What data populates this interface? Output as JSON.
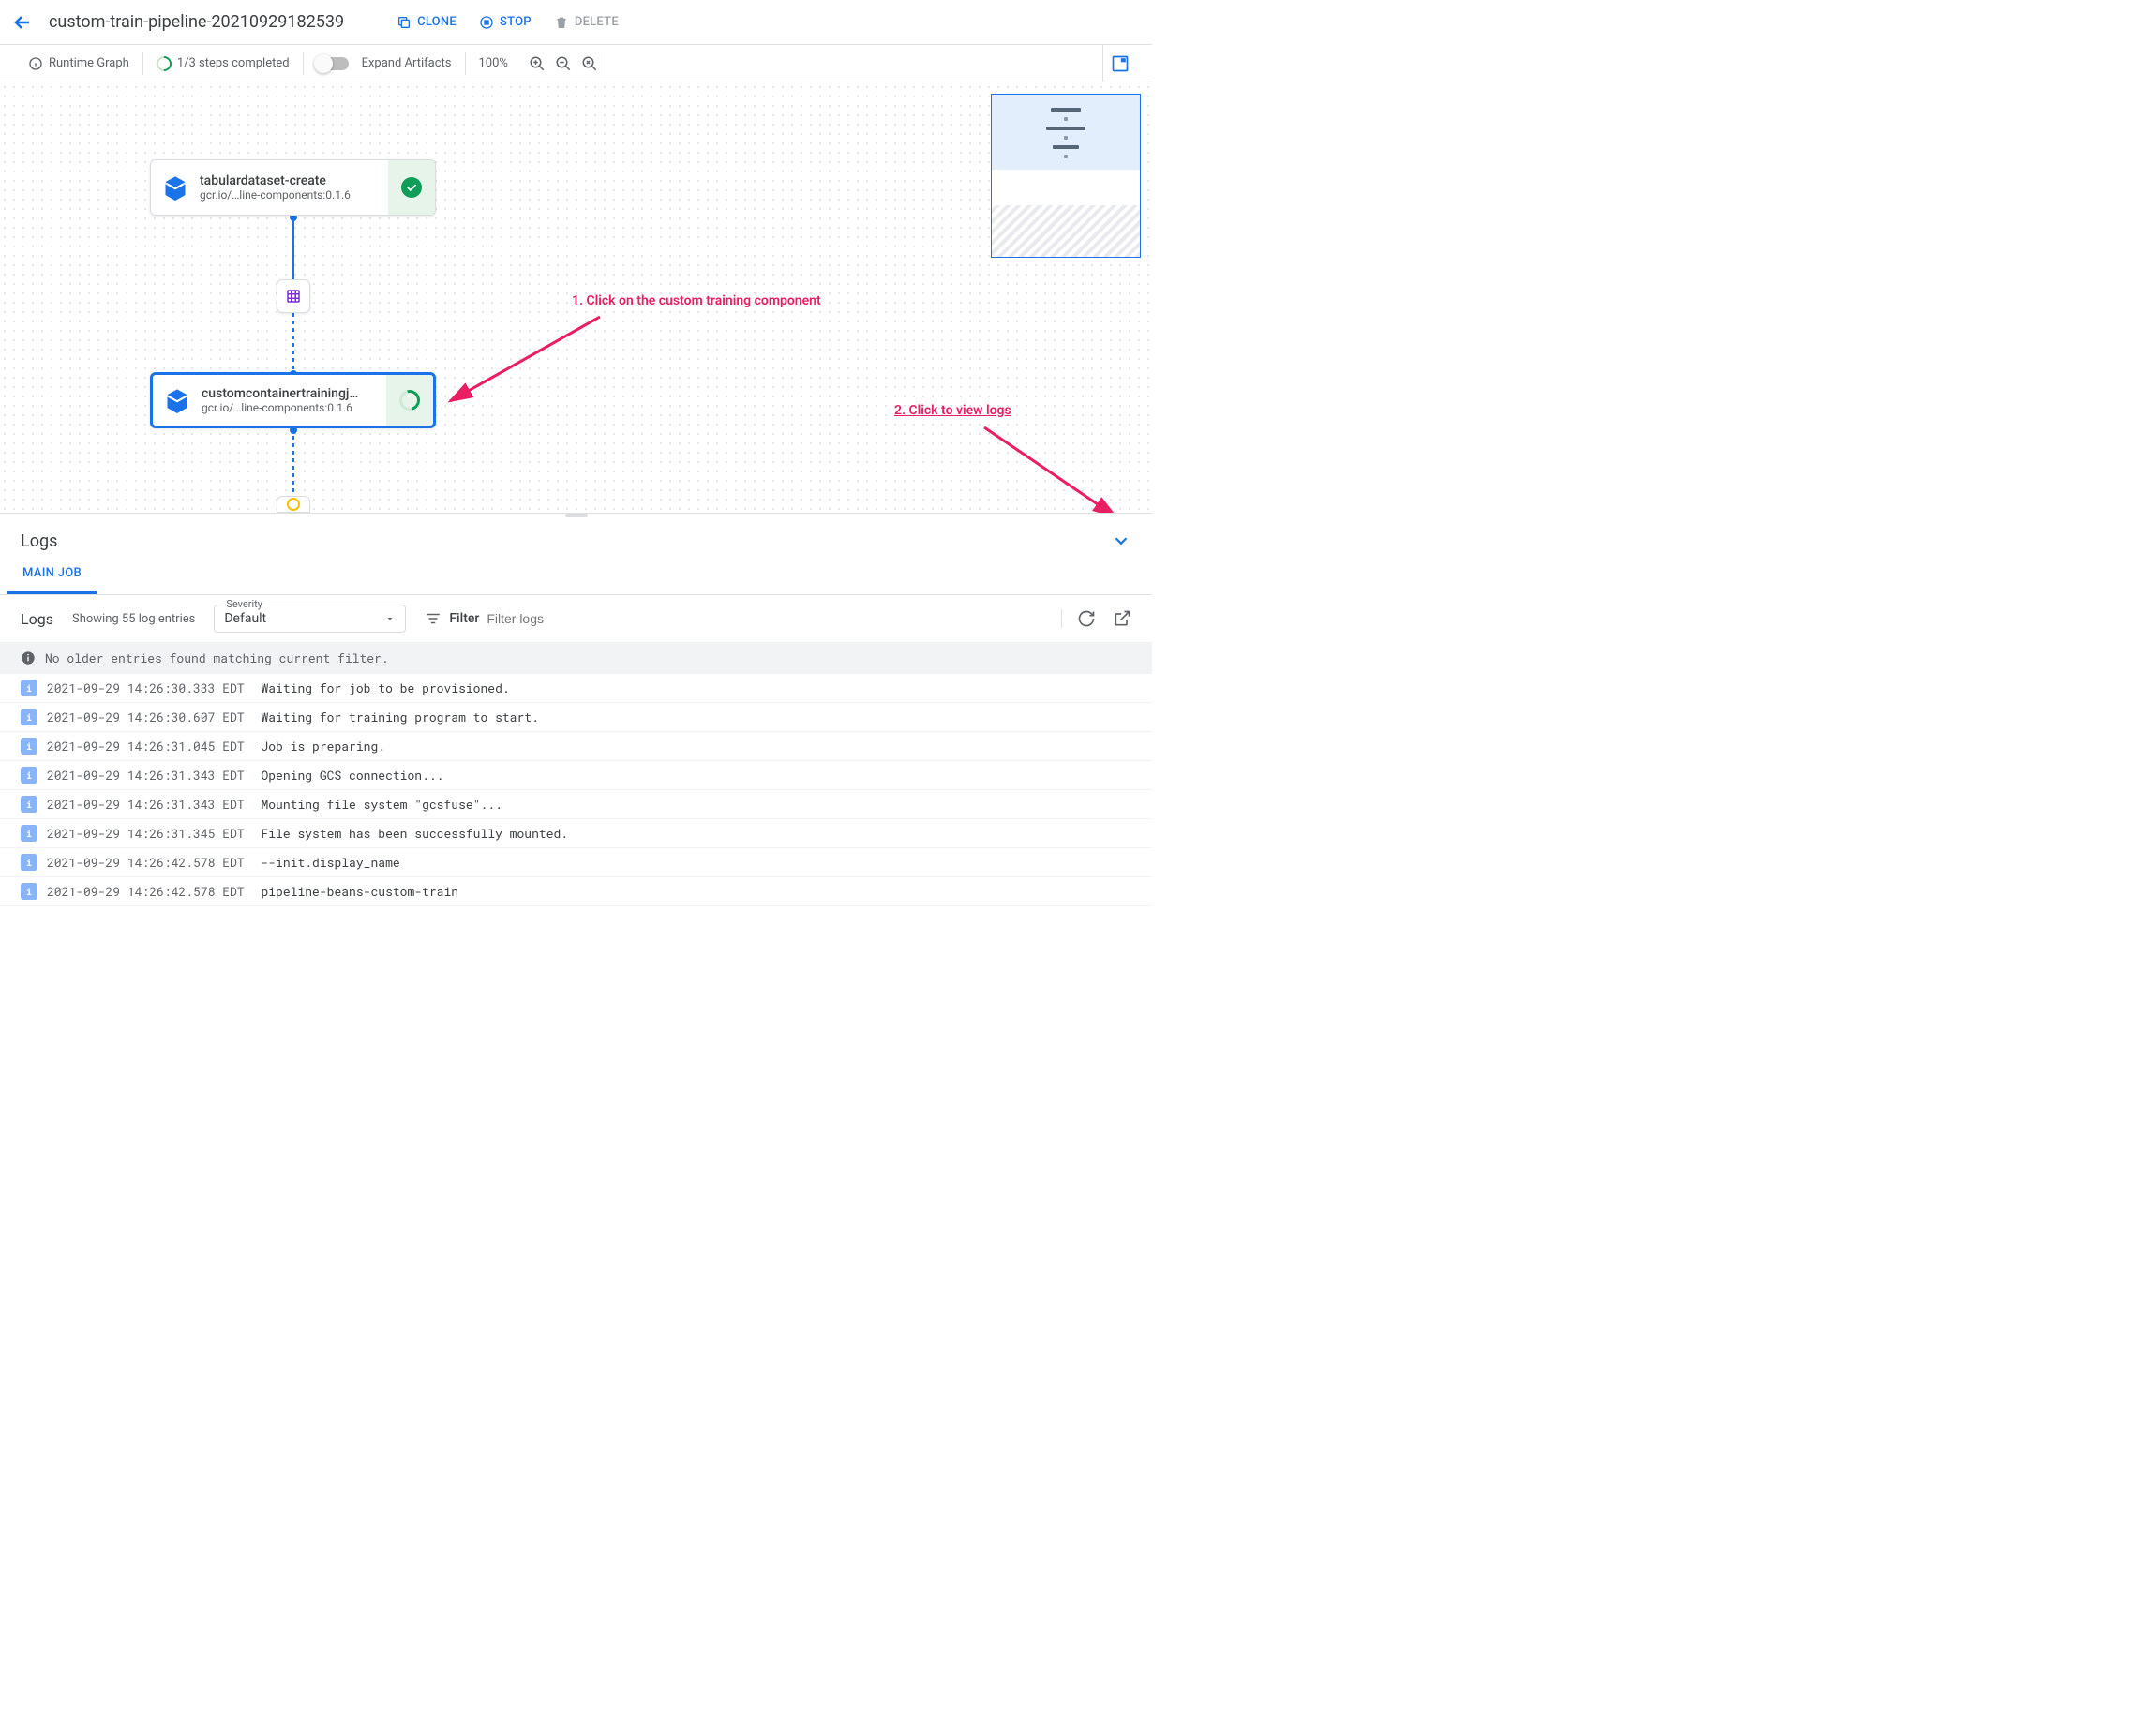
{
  "header": {
    "title": "custom-train-pipeline-20210929182539",
    "actions": {
      "clone": "CLONE",
      "stop": "STOP",
      "delete": "DELETE"
    }
  },
  "toolbar": {
    "runtime_label": "Runtime Graph",
    "progress": "1/3 steps completed",
    "expand_artifacts": "Expand Artifacts",
    "zoom": "100%"
  },
  "graph": {
    "nodes": [
      {
        "id": "tabulardataset",
        "title": "tabulardataset-create",
        "sub": "gcr.io/…line-components:0.1.6",
        "status": "complete"
      },
      {
        "id": "customtraining",
        "title": "customcontainertrainingj…",
        "sub": "gcr.io/…line-components:0.1.6",
        "status": "running"
      }
    ]
  },
  "annotations": {
    "a1": "1. Click on the custom training component",
    "a2": "2. Click to view logs"
  },
  "logs": {
    "panel_title": "Logs",
    "tab": "MAIN JOB",
    "filter_label": "Logs",
    "count_text": "Showing 55 log entries",
    "severity_label": "Severity",
    "severity_value": "Default",
    "filter_word": "Filter",
    "filter_placeholder": "Filter logs",
    "banner": "No older entries found matching current filter.",
    "entries": [
      {
        "ts": "2021-09-29 14:26:30.333 EDT",
        "msg": "Waiting for job to be provisioned."
      },
      {
        "ts": "2021-09-29 14:26:30.607 EDT",
        "msg": "Waiting for training program to start."
      },
      {
        "ts": "2021-09-29 14:26:31.045 EDT",
        "msg": "Job is preparing."
      },
      {
        "ts": "2021-09-29 14:26:31.343 EDT",
        "msg": "Opening GCS connection..."
      },
      {
        "ts": "2021-09-29 14:26:31.343 EDT",
        "msg": "Mounting file system \"gcsfuse\"..."
      },
      {
        "ts": "2021-09-29 14:26:31.345 EDT",
        "msg": "File system has been successfully mounted."
      },
      {
        "ts": "2021-09-29 14:26:42.578 EDT",
        "msg": "--init.display_name"
      },
      {
        "ts": "2021-09-29 14:26:42.578 EDT",
        "msg": "pipeline-beans-custom-train"
      }
    ]
  }
}
